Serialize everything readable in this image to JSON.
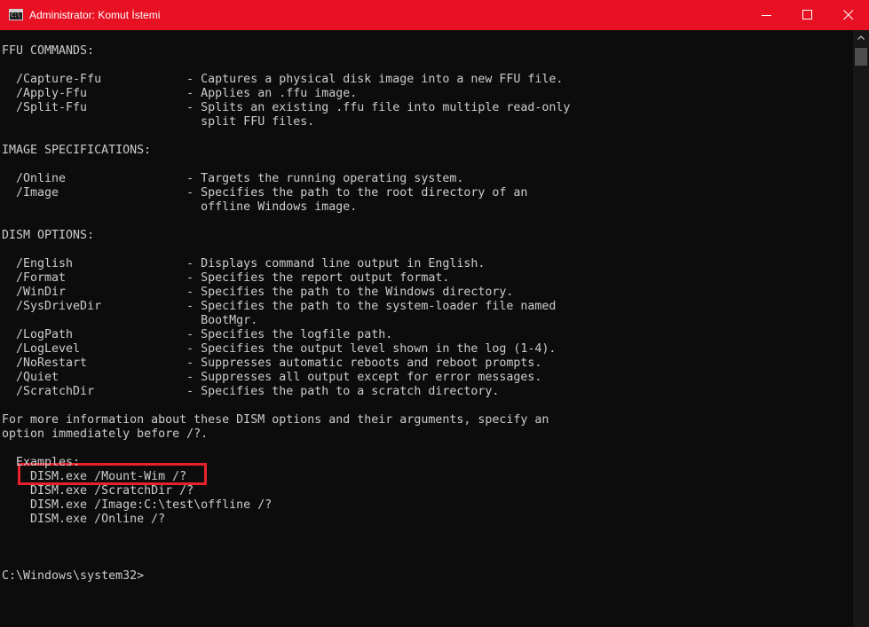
{
  "window": {
    "title": "Administrator: Komut İstemi",
    "icon_glyph": "C:\\"
  },
  "controls": {
    "minimize_icon": "minimize-icon",
    "maximize_icon": "maximize-icon",
    "close_icon": "close-icon"
  },
  "console": {
    "lines": [
      "FFU COMMANDS:",
      "",
      "  /Capture-Ffu            - Captures a physical disk image into a new FFU file.",
      "  /Apply-Ffu              - Applies an .ffu image.",
      "  /Split-Ffu              - Splits an existing .ffu file into multiple read-only",
      "                            split FFU files.",
      "",
      "IMAGE SPECIFICATIONS:",
      "",
      "  /Online                 - Targets the running operating system.",
      "  /Image                  - Specifies the path to the root directory of an",
      "                            offline Windows image.",
      "",
      "DISM OPTIONS:",
      "",
      "  /English                - Displays command line output in English.",
      "  /Format                 - Specifies the report output format.",
      "  /WinDir                 - Specifies the path to the Windows directory.",
      "  /SysDriveDir            - Specifies the path to the system-loader file named",
      "                            BootMgr.",
      "  /LogPath                - Specifies the logfile path.",
      "  /LogLevel               - Specifies the output level shown in the log (1-4).",
      "  /NoRestart              - Suppresses automatic reboots and reboot prompts.",
      "  /Quiet                  - Suppresses all output except for error messages.",
      "  /ScratchDir             - Specifies the path to a scratch directory.",
      "",
      "For more information about these DISM options and their arguments, specify an",
      "option immediately before /?.",
      "",
      "  Examples:",
      "    DISM.exe /Mount-Wim /?",
      "    DISM.exe /ScratchDir /?",
      "    DISM.exe /Image:C:\\test\\offline /?",
      "    DISM.exe /Online /?",
      "",
      "",
      "",
      "C:\\Windows\\system32>"
    ]
  },
  "colors": {
    "titlebar": "#e81123",
    "console_background": "#0c0c0c",
    "console_text": "#cccccc",
    "highlight_border": "#e8222a"
  }
}
